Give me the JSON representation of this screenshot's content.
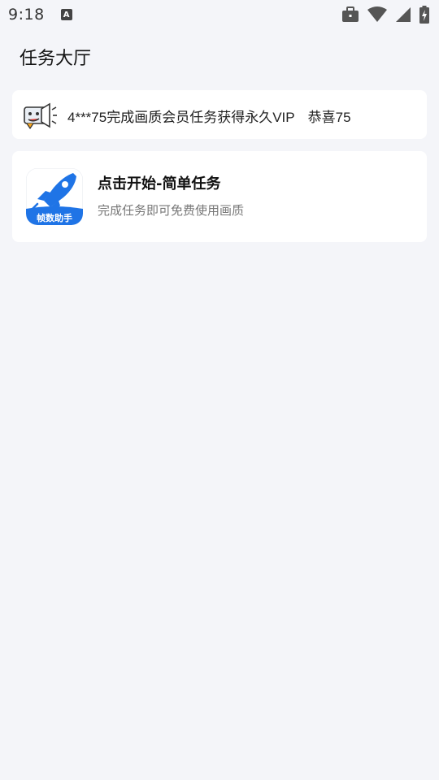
{
  "status_bar": {
    "time": "9:18",
    "notification_icon_letter": "A",
    "icons": [
      "a-notification-icon",
      "briefcase-icon",
      "wifi-icon",
      "signal-icon",
      "battery-charging-icon"
    ]
  },
  "page": {
    "title": "任务大厅"
  },
  "marquee": {
    "icon": "megaphone-icon",
    "messages": [
      "4***75完成画质会员任务获得永久VIP",
      "恭喜75"
    ]
  },
  "task": {
    "app_icon_label": "帧数助手",
    "title": "点击开始-简单任务",
    "subtitle": "完成任务即可免费使用画质"
  },
  "colors": {
    "background": "#f4f5f9",
    "card": "#ffffff",
    "brand_blue": "#1f74e6"
  }
}
